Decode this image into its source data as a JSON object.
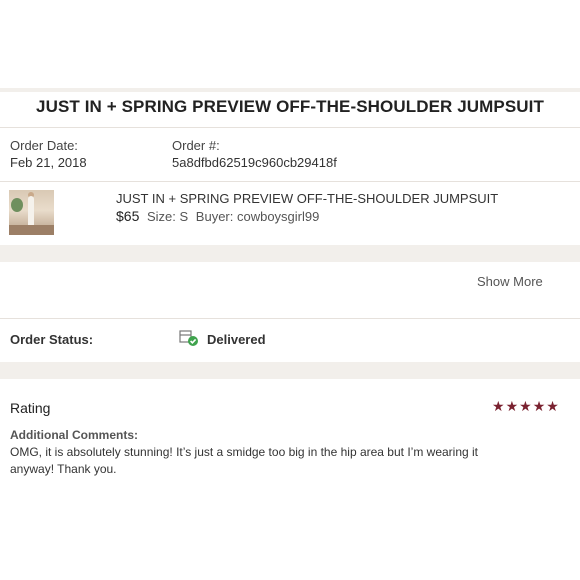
{
  "listing": {
    "title": "JUST IN + SPRING PREVIEW OFF-THE-SHOULDER JUMPSUIT"
  },
  "order": {
    "date_label": "Order Date:",
    "date_value": "Feb 21, 2018",
    "number_label": "Order #:",
    "number_value": "5a8dfbd62519c960cb29418f"
  },
  "item": {
    "name": "JUST IN + SPRING PREVIEW OFF-THE-SHOULDER JUMPSUIT",
    "price": "$65",
    "size": "Size: S",
    "buyer": "Buyer: cowboysgirl99"
  },
  "show_more": "Show More",
  "status": {
    "label": "Order Status:",
    "value": "Delivered",
    "icon": "delivered-box-check-icon",
    "check_color": "#3fa34d"
  },
  "rating": {
    "heading": "Rating",
    "stars": 5,
    "star_color": "#7a2230",
    "comments_label": "Additional Comments:",
    "comment_line1": "OMG, it is absolutely stunning! It’s just a smidge too big in the hip area but I’m wearing it",
    "comment_line2": "anyway! Thank you."
  }
}
